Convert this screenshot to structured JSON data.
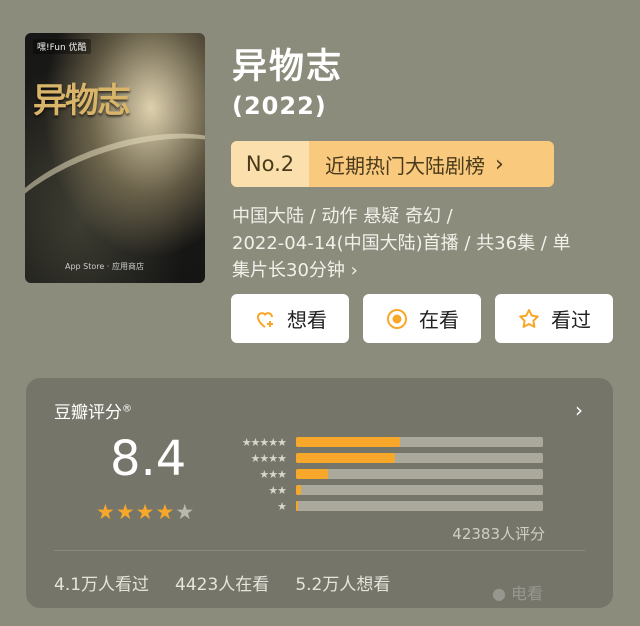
{
  "poster": {
    "title_art": "异物志",
    "brand": "嘿!Fun 优酷",
    "stores": "App Store · 应用商店"
  },
  "movie": {
    "title": "异物志",
    "year": "(2022)",
    "rank_no": "No.2",
    "rank_label": "近期热门大陆剧榜",
    "meta_line1": "中国大陆 / 动作 悬疑 奇幻 /",
    "meta_line2": "2022-04-14(中国大陆)首播 / 共36集 / 单",
    "meta_line3": "集片长30分钟 ›"
  },
  "actions": {
    "want": "想看",
    "watching": "在看",
    "watched": "看过"
  },
  "rating": {
    "header": "豆瓣评分",
    "reg_mark": "®",
    "score": "8.4",
    "stars_full": 4,
    "stars_empty": 1,
    "count": "42383人评分",
    "distribution": [
      {
        "stars": "★★★★★",
        "fraction": 0.42
      },
      {
        "stars": "★★★★",
        "fraction": 0.4
      },
      {
        "stars": "★★★",
        "fraction": 0.13
      },
      {
        "stars": "★★",
        "fraction": 0.02
      },
      {
        "stars": "★",
        "fraction": 0.01
      }
    ],
    "watched": "4.1万人看过",
    "watching": "4423人在看",
    "want": "5.2万人想看"
  },
  "watermark": "● 电看",
  "colors": {
    "accent": "#f7a82a",
    "rank_bg": "#f9c97d",
    "background": "#8c8c7d"
  }
}
